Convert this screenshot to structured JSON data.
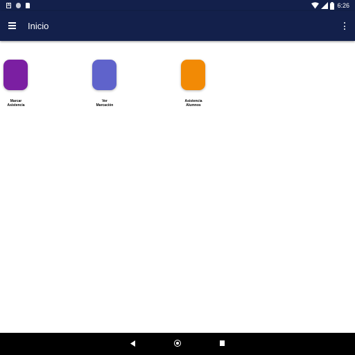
{
  "status_bar": {
    "time": "6:26",
    "notification_a": "A",
    "icons": [
      "notification-a-icon",
      "notification-circle-icon",
      "sd-card-icon",
      "wifi-icon",
      "signal-icon",
      "battery-icon"
    ]
  },
  "app_bar": {
    "title": "Inicio",
    "color": "#13204b",
    "icons": [
      "menu-icon",
      "more-vert-icon"
    ]
  },
  "tiles": [
    {
      "label": "Marcar\nAsistencia",
      "color": "#7b1fa2"
    },
    {
      "label": "Ver\nMarcación",
      "color": "#5f63cb"
    },
    {
      "label": "Asistencia\nAlumnos",
      "color": "#f28a05"
    }
  ],
  "nav_bar": {
    "icons": [
      "back-icon",
      "home-icon",
      "recents-icon"
    ]
  }
}
